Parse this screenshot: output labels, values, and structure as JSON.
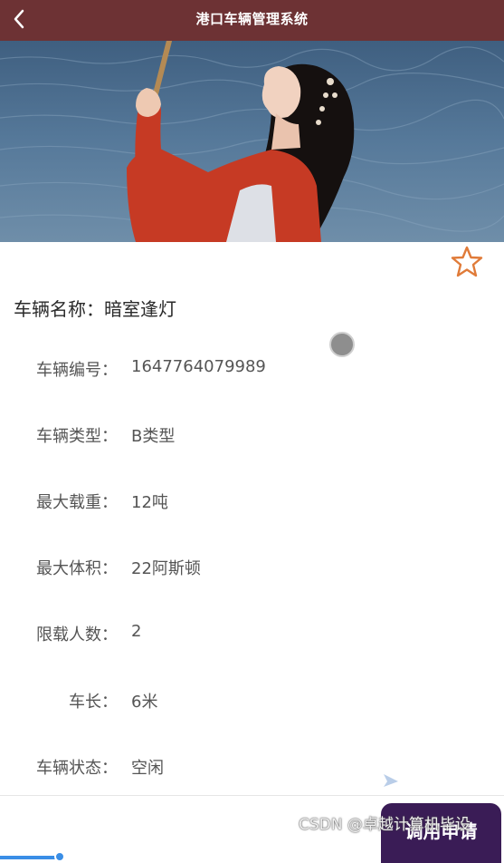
{
  "header": {
    "title": "港口车辆管理系统",
    "back_icon": "chevron-left-icon"
  },
  "banner": {
    "alt": "车辆图片"
  },
  "favorite": {
    "icon": "star-outline-icon",
    "color": "#e07b39"
  },
  "vehicle": {
    "name_label": "车辆名称：",
    "name_value": "暗室逢灯"
  },
  "details": [
    {
      "label": "车辆编号",
      "value": "1647764079989"
    },
    {
      "label": "车辆类型",
      "value": "B类型"
    },
    {
      "label": "最大载重",
      "value": "12吨"
    },
    {
      "label": "最大体积",
      "value": "22阿斯顿"
    },
    {
      "label": "限载人数",
      "value": "2"
    },
    {
      "label": "车长",
      "value": "6米"
    },
    {
      "label": "车辆状态",
      "value": "空闲"
    }
  ],
  "colon": "：",
  "actions": {
    "apply_label": "调用申请"
  },
  "watermark": "CSDN @卓越计算机毕设",
  "colors": {
    "header": "#6d3234",
    "apply_button": "#3a1c56",
    "star": "#e07b39"
  }
}
